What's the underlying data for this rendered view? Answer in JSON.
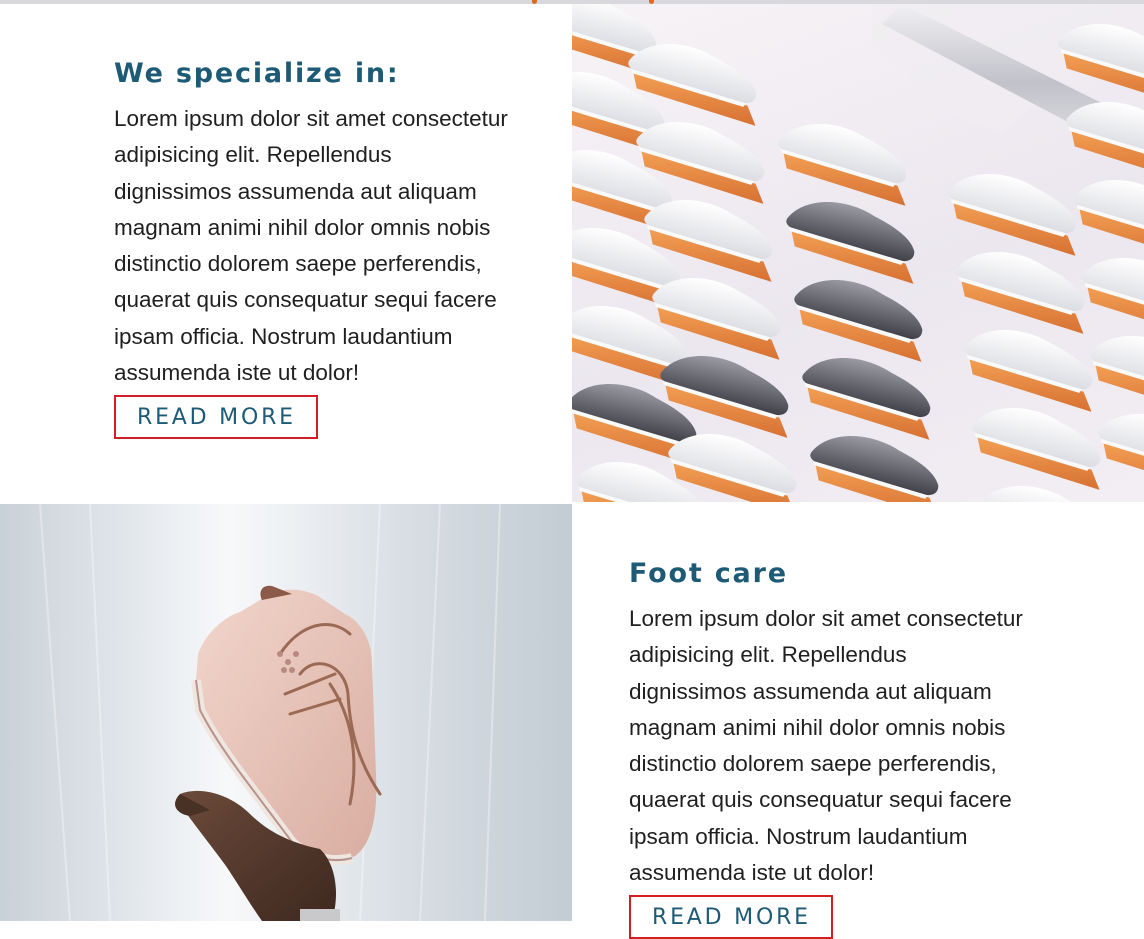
{
  "sections": [
    {
      "heading": "We specialize in:",
      "body": "Lorem ipsum dolor sit amet consectetur adipisicing elit. Repellendus dignissimos assumenda aut aliquam magnam animi nihil dolor omnis nobis distinctio dolorem saepe perferendis, quaerat quis consequatur sequi facere ipsam officia. Nostrum laudantium assumenda iste ut dolor!",
      "button_label": "READ MORE"
    },
    {
      "heading": "Foot care",
      "body": "Lorem ipsum dolor sit amet consectetur adipisicing elit. Repellendus dignissimos assumenda aut aliquam magnam animi nihil dolor omnis nobis distinctio dolorem saepe perferendis, quaerat quis consequatur sequi facere ipsam officia. Nostrum laudantium assumenda iste ut dolor!",
      "button_label": "READ MORE"
    }
  ],
  "images": [
    {
      "icon": "sneaker-wall-photo"
    },
    {
      "icon": "sneaker-hand-photo"
    }
  ],
  "colors": {
    "heading": "#1d5a76",
    "button_border": "#d21e24",
    "accent_orange": "#e06a1f"
  }
}
